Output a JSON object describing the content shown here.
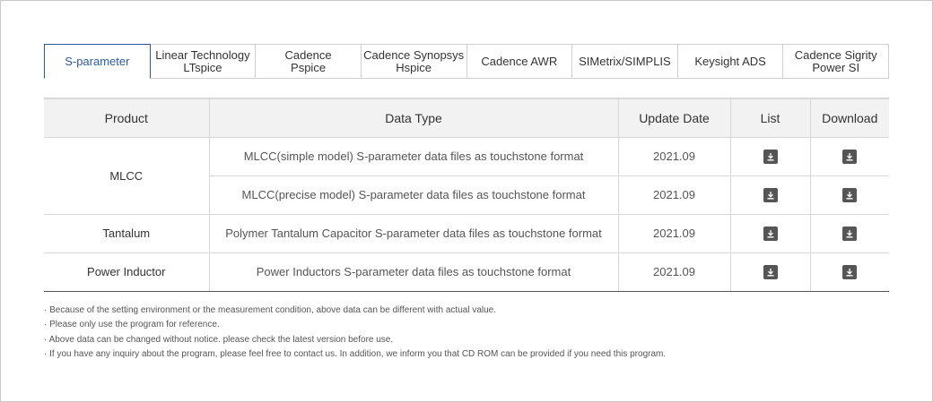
{
  "tabs": [
    {
      "label": "S-parameter",
      "active": true
    },
    {
      "label": "Linear Technology\nLTspice",
      "active": false
    },
    {
      "label": "Cadence\nPspice",
      "active": false
    },
    {
      "label": "Cadence Synopsys\nHspice",
      "active": false
    },
    {
      "label": "Cadence AWR",
      "active": false
    },
    {
      "label": "SIMetrix/SIMPLIS",
      "active": false
    },
    {
      "label": "Keysight ADS",
      "active": false
    },
    {
      "label": "Cadence Sigrity\nPower SI",
      "active": false
    }
  ],
  "table": {
    "headers": {
      "product": "Product",
      "data_type": "Data Type",
      "update_date": "Update Date",
      "list": "List",
      "download": "Download"
    },
    "rows": [
      {
        "product": "MLCC",
        "data_type": "MLCC(simple model) S-parameter data files as touchstone format",
        "update_date": "2021.09"
      },
      {
        "product": "MLCC",
        "data_type": "MLCC(precise model) S-parameter data files as touchstone format",
        "update_date": "2021.09"
      },
      {
        "product": "Tantalum",
        "data_type": "Polymer Tantalum Capacitor S-parameter data files as touchstone format",
        "update_date": "2021.09"
      },
      {
        "product": "Power Inductor",
        "data_type": "Power Inductors S-parameter data files as touchstone format",
        "update_date": "2021.09"
      }
    ],
    "icon": "download-icon"
  },
  "notes": [
    "Because of the setting environment or the measurement condition, above data can be different with actual value.",
    "Please only use the program for reference.",
    "Above data can be changed without notice. please check the latest version before use.",
    "If you have any inquiry about the program, please feel free to contact us. In addition, we inform you that CD ROM can be provided if you need this program."
  ],
  "colors": {
    "accent": "#2c5aa0",
    "header_bg": "#f2f2f2",
    "icon_bg": "#555555"
  }
}
